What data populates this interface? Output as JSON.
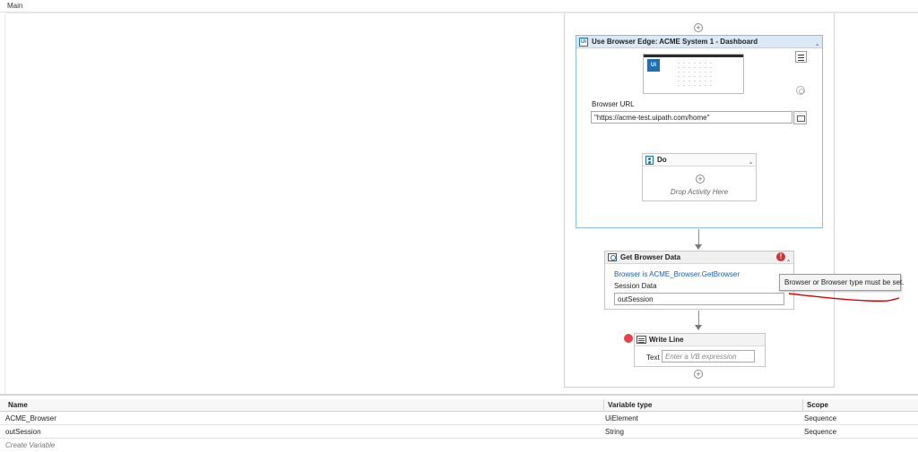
{
  "tab": {
    "title": "Main"
  },
  "use_browser": {
    "title": "Use Browser Edge: ACME System 1 - Dashboard",
    "thumbnail_logo": "Ui",
    "browser_url_label": "Browser URL",
    "browser_url_value": "\"https://acme-test.uipath.com/home\"",
    "header_icon": "uipath-logo-icon"
  },
  "do_block": {
    "title": "Do",
    "drop_hint": "Drop Activity Here"
  },
  "get_browser_data": {
    "title": "Get Browser Data",
    "browser_link": "Browser is ACME_Browser.GetBrowser",
    "session_label": "Session Data",
    "session_value": "outSession",
    "tooltip": "Browser or Browser type must be set.",
    "error_color": "#d13438"
  },
  "write_line": {
    "title": "Write Line",
    "text_label": "Text",
    "text_placeholder": "Enter a VB expression",
    "breakpoint_color": "#e8404a"
  },
  "variables": {
    "columns": [
      "Name",
      "Variable type",
      "Scope"
    ],
    "rows": [
      {
        "name": "ACME_Browser",
        "type": "UiElement",
        "scope": "Sequence"
      },
      {
        "name": "outSession",
        "type": "String",
        "scope": "Sequence"
      }
    ],
    "create_label": "Create Variable"
  },
  "colors": {
    "accent": "#1f6fb5",
    "link": "#1a5fb4",
    "annotation": "#e00000"
  }
}
